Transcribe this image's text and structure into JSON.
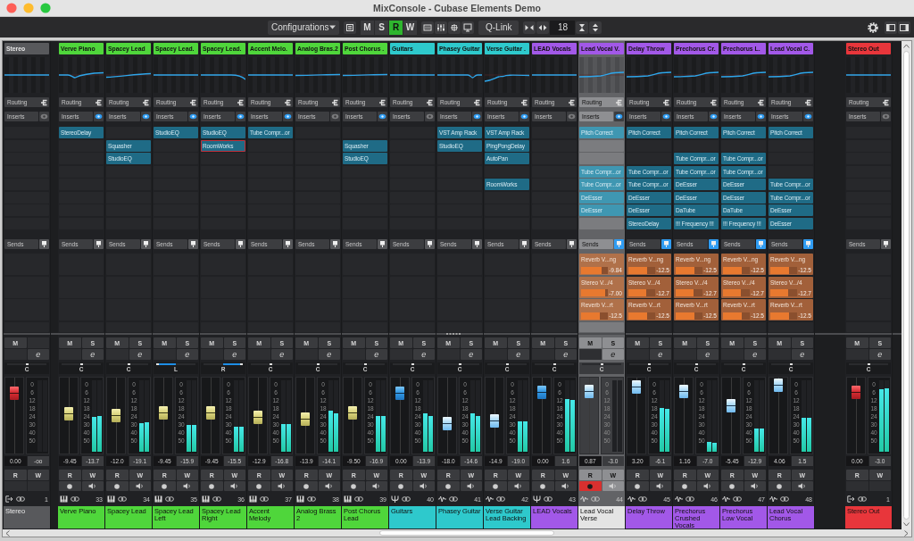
{
  "window": {
    "title": "MixConsole - Cubase Elements Demo"
  },
  "toolbar": {
    "configurations": "Configurations",
    "modes": [
      {
        "label": "M",
        "on": false
      },
      {
        "label": "S",
        "on": false
      },
      {
        "label": "R",
        "on": true
      },
      {
        "label": "W",
        "on": false
      }
    ],
    "qlink": "Q-Link",
    "visible_channels": "18"
  },
  "input_strip": {
    "name": "Stereo",
    "color": "#58595c",
    "kind": "input",
    "selected": false,
    "eq": {
      "kind": "flat"
    },
    "routing": "Routing",
    "inserts_label": "Inserts",
    "inserts_on": false,
    "sends_label": "Sends",
    "sends_on": false,
    "mute": "M",
    "edit": "e",
    "pan": {
      "label": "C",
      "level": 0.5
    },
    "fader": {
      "level": 0.86
    },
    "scale": [
      "0",
      "6",
      "12",
      "18",
      "24",
      "30",
      "40",
      "50"
    ],
    "volume": "0.00",
    "peak": "-oo",
    "read": "R",
    "write": "W",
    "number": "1",
    "full_name": "Stereo"
  },
  "channels": [
    {
      "name": "Verve Piano",
      "color": "#4fd63b",
      "kind": "instrument",
      "selected": false,
      "eq": {
        "kind": "dip"
      },
      "routing": "Routing",
      "inserts_label": "Inserts",
      "inserts_on": true,
      "inserts": [
        {
          "kind": "plugin",
          "name": "StereoDelay"
        }
      ],
      "sends_label": "Sends",
      "sends_on": false,
      "mute": "M",
      "solo": "S",
      "edit": "e",
      "pan": {
        "label": "C",
        "level": 0.5
      },
      "fader": {
        "level": 0.53
      },
      "scale": [
        "0",
        "6",
        "12",
        "18",
        "24",
        "30",
        "40",
        "50"
      ],
      "meter": [
        {
          "level": 0.49
        },
        {
          "level": 0.5
        }
      ],
      "volume": "-9.45",
      "peak": "-13.7",
      "read": "R",
      "write": "W",
      "record": false,
      "number": "33",
      "full_name": "Verve Piano"
    },
    {
      "name": "Spacey Lead",
      "color": "#4fd63b",
      "kind": "instrument",
      "selected": false,
      "eq": {
        "kind": "rise"
      },
      "routing": "Routing",
      "inserts_label": "Inserts",
      "inserts_on": true,
      "inserts": [
        {
          "kind": "empty"
        },
        {
          "kind": "plugin",
          "name": "Squasher"
        },
        {
          "kind": "plugin",
          "name": "StudioEQ"
        }
      ],
      "sends_label": "Sends",
      "sends_on": false,
      "mute": "M",
      "solo": "S",
      "edit": "e",
      "pan": {
        "label": "C",
        "level": 0.5
      },
      "fader": {
        "level": 0.5
      },
      "scale": [
        "0",
        "6",
        "12",
        "18",
        "24",
        "30",
        "40",
        "50"
      ],
      "meter": [
        {
          "level": 0.4
        },
        {
          "level": 0.41
        }
      ],
      "volume": "-12.0",
      "peak": "-19.1",
      "read": "R",
      "write": "W",
      "record": false,
      "number": "34",
      "full_name": "Spacey Lead"
    },
    {
      "name": "Spacey Lead.",
      "color": "#4fd63b",
      "kind": "instrument",
      "selected": false,
      "eq": {
        "kind": "flat"
      },
      "routing": "Routing",
      "inserts_label": "Inserts",
      "inserts_on": true,
      "inserts": [
        {
          "kind": "plugin",
          "name": "StudioEQ"
        }
      ],
      "sends_label": "Sends",
      "sends_on": false,
      "mute": "M",
      "solo": "S",
      "edit": "e",
      "pan": {
        "label": "L",
        "level": 0
      },
      "fader": {
        "level": 0.54
      },
      "scale": [
        "0",
        "6",
        "12",
        "18",
        "24",
        "30",
        "40",
        "50"
      ],
      "meter": [
        {
          "level": 0.37
        },
        {
          "level": 0.37
        }
      ],
      "volume": "-9.45",
      "peak": "-15.9",
      "read": "R",
      "write": "W",
      "record": false,
      "number": "35",
      "full_name": "Spacey Lead Left"
    },
    {
      "name": "Spacey Lead.",
      "color": "#4fd63b",
      "kind": "instrument",
      "selected": false,
      "eq": {
        "kind": "fall"
      },
      "routing": "Routing",
      "inserts_label": "Inserts",
      "inserts_on": true,
      "inserts": [
        {
          "kind": "plugin",
          "name": "StudioEQ"
        },
        {
          "kind": "marked",
          "name": "RoomWorks"
        }
      ],
      "sends_label": "Sends",
      "sends_on": false,
      "mute": "M",
      "solo": "S",
      "edit": "e",
      "pan": {
        "label": "R",
        "level": 1
      },
      "fader": {
        "level": 0.54
      },
      "scale": [
        "0",
        "6",
        "12",
        "18",
        "24",
        "30",
        "40",
        "50"
      ],
      "meter": [
        {
          "level": 0.35
        },
        {
          "level": 0.35
        }
      ],
      "volume": "-9.45",
      "peak": "-15.5",
      "read": "R",
      "write": "W",
      "record": false,
      "number": "36",
      "full_name": "Spacey Lead Right"
    },
    {
      "name": "Accent Melo.",
      "color": "#4fd63b",
      "kind": "instrument",
      "selected": false,
      "eq": {
        "kind": "flat"
      },
      "routing": "Routing",
      "inserts_label": "Inserts",
      "inserts_on": true,
      "inserts": [
        {
          "kind": "plugin",
          "name": "Tube Compr...or"
        }
      ],
      "sends_label": "Sends",
      "sends_on": false,
      "mute": "M",
      "solo": "S",
      "edit": "e",
      "pan": {
        "label": "C",
        "level": 0.5
      },
      "fader": {
        "level": 0.47
      },
      "scale": [
        "0",
        "6",
        "12",
        "18",
        "24",
        "30",
        "40",
        "50"
      ],
      "meter": [
        {
          "level": 0.39
        },
        {
          "level": 0.39
        }
      ],
      "volume": "-12.9",
      "peak": "-16.8",
      "read": "R",
      "write": "W",
      "record": false,
      "number": "37",
      "full_name": "Accent Melody"
    },
    {
      "name": "Analog Bras.2",
      "color": "#4fd63b",
      "kind": "instrument",
      "selected": false,
      "eq": {
        "kind": "gentle"
      },
      "routing": "Routing",
      "inserts_label": "Inserts",
      "inserts_on": false,
      "sends_label": "Sends",
      "sends_on": false,
      "mute": "M",
      "solo": "S",
      "edit": "e",
      "pan": {
        "label": "C",
        "level": 0.5
      },
      "fader": {
        "level": 0.44
      },
      "scale": [
        "0",
        "6",
        "12",
        "18",
        "24",
        "30",
        "40",
        "50"
      ],
      "meter": [
        {
          "level": 0.57
        },
        {
          "level": 0.54
        }
      ],
      "volume": "-13.9",
      "peak": "-14.1",
      "read": "R",
      "write": "W",
      "record": false,
      "number": "38",
      "full_name": "Analog Brass 2"
    },
    {
      "name": "Post Chorus .",
      "color": "#4fd63b",
      "kind": "instrument",
      "selected": false,
      "eq": {
        "kind": "gentle"
      },
      "routing": "Routing",
      "inserts_label": "Inserts",
      "inserts_on": true,
      "inserts": [
        {
          "kind": "empty"
        },
        {
          "kind": "plugin",
          "name": "Squasher"
        },
        {
          "kind": "plugin",
          "name": "StudioEQ"
        }
      ],
      "sends_label": "Sends",
      "sends_on": false,
      "mute": "M",
      "solo": "S",
      "edit": "e",
      "pan": {
        "label": "C",
        "level": 0.5
      },
      "fader": {
        "level": 0.54
      },
      "scale": [
        "0",
        "6",
        "12",
        "18",
        "24",
        "30",
        "40",
        "50"
      ],
      "meter": [
        {
          "level": 0.5
        },
        {
          "level": 0.5
        }
      ],
      "volume": "-9.50",
      "peak": "-16.9",
      "read": "R",
      "write": "W",
      "record": false,
      "number": "39",
      "full_name": "Post Chorus Lead"
    },
    {
      "name": "Guitars",
      "color": "#2ec9cc",
      "kind": "group",
      "selected": false,
      "eq": {
        "kind": "flat"
      },
      "routing": "Routing",
      "inserts_label": "Inserts",
      "inserts_on": false,
      "sends_label": "Sends",
      "sends_on": false,
      "mute": "M",
      "solo": "S",
      "edit": "e",
      "pan": {
        "label": "C",
        "level": 0.5
      },
      "fader": {
        "level": 0.86
      },
      "scale": [
        "0",
        "6",
        "12",
        "18",
        "24",
        "30",
        "40",
        "50"
      ],
      "meter": [
        {
          "level": 0.54
        },
        {
          "level": 0.5
        }
      ],
      "volume": "0.00",
      "peak": "-13.9",
      "read": "R",
      "write": "W",
      "record": false,
      "number": "40",
      "full_name": "Guitars"
    },
    {
      "name": "Phasey Guitar",
      "color": "#2ec9cc",
      "kind": "audio",
      "selected": false,
      "eq": {
        "kind": "notch"
      },
      "routing": "Routing",
      "inserts_label": "Inserts",
      "inserts_on": true,
      "inserts": [
        {
          "kind": "plugin",
          "name": "VST Amp Rack"
        },
        {
          "kind": "plugin",
          "name": "StudioEQ"
        }
      ],
      "sends_label": "Sends",
      "sends_on": false,
      "mute": "M",
      "solo": "S",
      "edit": "e",
      "pan": {
        "label": "C",
        "level": 0.5
      },
      "fader": {
        "level": 0.37
      },
      "scale": [
        "0",
        "6",
        "12",
        "18",
        "24",
        "30",
        "40",
        "50"
      ],
      "meter": [
        {
          "level": 0.54
        },
        {
          "level": 0.5
        }
      ],
      "volume": "-18.0",
      "peak": "-14.6",
      "read": "R",
      "write": "W",
      "record": false,
      "number": "41",
      "full_name": "Phasey Guitar"
    },
    {
      "name": "Verse Guitar .",
      "color": "#2ec9cc",
      "kind": "audio",
      "selected": false,
      "eq": {
        "kind": "lowcut"
      },
      "routing": "Routing",
      "inserts_label": "Inserts",
      "inserts_on": true,
      "inserts": [
        {
          "kind": "plugin",
          "name": "VST Amp Rack"
        },
        {
          "kind": "plugin",
          "name": "PingPongDelay"
        },
        {
          "kind": "plugin",
          "name": "AutoPan"
        },
        {
          "kind": "empty"
        },
        {
          "kind": "plugin",
          "name": "RoomWorks"
        }
      ],
      "sends_label": "Sends",
      "sends_on": false,
      "mute": "M",
      "solo": "S",
      "edit": "e",
      "pan": {
        "label": "C",
        "level": 0.5
      },
      "fader": {
        "level": 0.41
      },
      "scale": [
        "0",
        "6",
        "12",
        "18",
        "24",
        "30",
        "40",
        "50"
      ],
      "meter": [
        {
          "level": 0.42
        },
        {
          "level": 0.42
        }
      ],
      "volume": "-14.9",
      "peak": "-19.0",
      "read": "R",
      "write": "W",
      "record": false,
      "number": "42",
      "full_name": "Verse Guitar Lead Backing"
    },
    {
      "name": "LEAD Vocals",
      "color": "#a258e8",
      "kind": "group",
      "selected": false,
      "eq": {
        "kind": "flat"
      },
      "routing": "Routing",
      "inserts_label": "Inserts",
      "inserts_on": false,
      "sends_label": "Sends",
      "sends_on": false,
      "mute": "M",
      "solo": "S",
      "edit": "e",
      "pan": {
        "label": "C",
        "level": 0.5
      },
      "fader": {
        "level": 0.87
      },
      "scale": [
        "0",
        "6",
        "12",
        "18",
        "24",
        "30",
        "40",
        "50"
      ],
      "meter": [
        {
          "level": 0.74
        },
        {
          "level": 0.72
        }
      ],
      "volume": "0.00",
      "peak": "1.6",
      "read": "R",
      "write": "W",
      "record": false,
      "number": "43",
      "full_name": "LEAD Vocals"
    },
    {
      "name": "Lead Vocal V.",
      "color": "#a258e8",
      "kind": "audio",
      "selected": true,
      "eq": {
        "kind": "vocal"
      },
      "routing": "Routing",
      "inserts_label": "Inserts",
      "inserts_on": true,
      "inserts": [
        {
          "kind": "plugin",
          "name": "Pitch Correct"
        },
        {
          "kind": "empty"
        },
        {
          "kind": "empty"
        },
        {
          "kind": "plugin",
          "name": "Tube Compr...or"
        },
        {
          "kind": "plugin",
          "name": "Tube Compr...or"
        },
        {
          "kind": "plugin",
          "name": "DeEsser"
        },
        {
          "kind": "plugin",
          "name": "DeEsser"
        }
      ],
      "sends_label": "Sends",
      "sends_on": true,
      "sends": [
        {
          "name": "Reverb V...ng",
          "level": 0.78,
          "value": "-9.84"
        },
        {
          "name": "Stereo V.../4",
          "level": 0.91,
          "value": "-7.00"
        },
        {
          "name": "Reverb V...rt",
          "level": 0.69,
          "value": "-12.5"
        }
      ],
      "mute": "M",
      "solo": "S",
      "edit": "e",
      "pan": {
        "label": "C",
        "level": 0.5
      },
      "fader": {
        "level": 0.89
      },
      "scale": [
        "0",
        "6",
        "12",
        "18",
        "24",
        "30",
        "40",
        "50"
      ],
      "volume": "0.87",
      "peak": "-3.0",
      "read": "R",
      "write": "W",
      "record": true,
      "number": "44",
      "full_name": "Lead Vocal Verse"
    },
    {
      "name": "Delay Throw",
      "color": "#a258e8",
      "kind": "audio",
      "selected": false,
      "eq": {
        "kind": "vocal"
      },
      "routing": "Routing",
      "inserts_label": "Inserts",
      "inserts_on": true,
      "inserts": [
        {
          "kind": "plugin",
          "name": "Pitch Correct"
        },
        {
          "kind": "empty"
        },
        {
          "kind": "empty"
        },
        {
          "kind": "plugin",
          "name": "Tube Compr...or"
        },
        {
          "kind": "plugin",
          "name": "Tube Compr...or"
        },
        {
          "kind": "plugin",
          "name": "DeEsser"
        },
        {
          "kind": "plugin",
          "name": "DeEsser"
        },
        {
          "kind": "plugin",
          "name": "StereoDelay"
        }
      ],
      "sends_label": "Sends",
      "sends_on": true,
      "sends": [
        {
          "name": "Reverb V...ng",
          "level": 0.69,
          "value": "-12.5"
        },
        {
          "name": "Stereo V.../4",
          "level": 0.67,
          "value": "-12.7"
        },
        {
          "name": "Reverb V...rt",
          "level": 0.69,
          "value": "-12.5"
        }
      ],
      "mute": "M",
      "solo": "S",
      "edit": "e",
      "pan": {
        "label": "C",
        "level": 0.5
      },
      "fader": {
        "level": 0.96
      },
      "scale": [
        "0",
        "6",
        "12",
        "18",
        "24",
        "30",
        "40",
        "50"
      ],
      "meter": [
        {
          "level": 0.61
        },
        {
          "level": 0.6
        }
      ],
      "volume": "3.20",
      "peak": "-6.1",
      "read": "R",
      "write": "W",
      "record": false,
      "number": "45",
      "full_name": "Delay Throw"
    },
    {
      "name": "Prechorus Cr.",
      "color": "#a258e8",
      "kind": "audio",
      "selected": false,
      "eq": {
        "kind": "vocal"
      },
      "routing": "Routing",
      "inserts_label": "Inserts",
      "inserts_on": true,
      "inserts": [
        {
          "kind": "plugin",
          "name": "Pitch Correct"
        },
        {
          "kind": "empty"
        },
        {
          "kind": "plugin",
          "name": "Tube Compr...or"
        },
        {
          "kind": "plugin",
          "name": "Tube Compr...or"
        },
        {
          "kind": "plugin",
          "name": "DeEsser"
        },
        {
          "kind": "plugin",
          "name": "DeEsser"
        },
        {
          "kind": "plugin",
          "name": "DaTube"
        },
        {
          "kind": "plugin",
          "name": "!!! Frequency !!!"
        }
      ],
      "sends_label": "Sends",
      "sends_on": true,
      "sends": [
        {
          "name": "Reverb V...ng",
          "level": 0.69,
          "value": "-12.5"
        },
        {
          "name": "Stereo V.../4",
          "level": 0.67,
          "value": "-12.7"
        },
        {
          "name": "Reverb V...rt",
          "level": 0.69,
          "value": "-12.5"
        }
      ],
      "mute": "M",
      "solo": "S",
      "edit": "e",
      "pan": {
        "label": "C",
        "level": 0.5
      },
      "fader": {
        "level": 0.89
      },
      "scale": [
        "0",
        "6",
        "12",
        "18",
        "24",
        "30",
        "40",
        "50"
      ],
      "meter": [
        {
          "level": 0.14
        },
        {
          "level": 0.13
        }
      ],
      "volume": "1.16",
      "peak": "-7.0",
      "read": "R",
      "write": "W",
      "record": false,
      "number": "46",
      "full_name": "Prechorus Crushed Vocals"
    },
    {
      "name": "Prechorus L.",
      "color": "#a258e8",
      "kind": "audio",
      "selected": false,
      "eq": {
        "kind": "vocal"
      },
      "routing": "Routing",
      "inserts_label": "Inserts",
      "inserts_on": true,
      "inserts": [
        {
          "kind": "plugin",
          "name": "Pitch Correct"
        },
        {
          "kind": "empty"
        },
        {
          "kind": "plugin",
          "name": "Tube Compr...or"
        },
        {
          "kind": "plugin",
          "name": "Tube Compr...or"
        },
        {
          "kind": "plugin",
          "name": "DeEsser"
        },
        {
          "kind": "plugin",
          "name": "DeEsser"
        },
        {
          "kind": "plugin",
          "name": "DaTube"
        },
        {
          "kind": "plugin",
          "name": "!!! Frequency !!!"
        }
      ],
      "sends_label": "Sends",
      "sends_on": true,
      "sends": [
        {
          "name": "Reverb V...ng",
          "level": 0.69,
          "value": "-12.5"
        },
        {
          "name": "Stereo V.../4",
          "level": 0.67,
          "value": "-12.7"
        },
        {
          "name": "Reverb V...rt",
          "level": 0.69,
          "value": "-12.5"
        }
      ],
      "mute": "M",
      "solo": "S",
      "edit": "e",
      "pan": {
        "label": "C",
        "level": 0.5
      },
      "fader": {
        "level": 0.66
      },
      "scale": [
        "0",
        "6",
        "12",
        "18",
        "24",
        "30",
        "40",
        "50"
      ],
      "meter": [
        {
          "level": 0.32
        },
        {
          "level": 0.32
        }
      ],
      "volume": "-5.45",
      "peak": "-12.9",
      "read": "R",
      "write": "W",
      "record": false,
      "number": "47",
      "full_name": "Prechorus Low Vocal"
    },
    {
      "name": "Lead Vocal C.",
      "color": "#a258e8",
      "kind": "audio",
      "selected": false,
      "eq": {
        "kind": "vocal"
      },
      "routing": "Routing",
      "inserts_label": "Inserts",
      "inserts_on": true,
      "inserts": [
        {
          "kind": "plugin",
          "name": "Pitch Correct"
        },
        {
          "kind": "empty"
        },
        {
          "kind": "empty"
        },
        {
          "kind": "empty"
        },
        {
          "kind": "plugin",
          "name": "Tube Compr...or"
        },
        {
          "kind": "plugin",
          "name": "Tube Compr...or"
        },
        {
          "kind": "plugin",
          "name": "DeEsser"
        },
        {
          "kind": "plugin",
          "name": "DeEsser"
        }
      ],
      "sends_label": "Sends",
      "sends_on": true,
      "sends": [
        {
          "name": "Reverb V...ng",
          "level": 0.69,
          "value": "-12.5"
        },
        {
          "name": "Stereo V.../4",
          "level": 0.67,
          "value": "-12.7"
        },
        {
          "name": "Reverb V...rt",
          "level": 0.69,
          "value": "-12.5"
        }
      ],
      "mute": "M",
      "solo": "S",
      "edit": "e",
      "pan": {
        "label": "C",
        "level": 0.5
      },
      "fader": {
        "level": 0.99
      },
      "scale": [
        "0",
        "6",
        "12",
        "18",
        "24",
        "30",
        "40",
        "50"
      ],
      "meter": [
        {
          "level": 0.47
        },
        {
          "level": 0.47
        }
      ],
      "volume": "4.06",
      "peak": "1.5",
      "read": "R",
      "write": "W",
      "record": false,
      "number": "48",
      "full_name": "Lead Vocal Chorus"
    }
  ],
  "output_strip": {
    "name": "Stereo Out",
    "color": "#e8363b",
    "kind": "output",
    "selected": false,
    "eq": {
      "kind": "flat"
    },
    "routing": "Routing",
    "inserts_label": "Inserts",
    "inserts_on": false,
    "sends_label": "Sends",
    "sends_on": false,
    "mute": "M",
    "solo": "S",
    "edit": "e",
    "pan": {
      "label": "C",
      "level": 0.5
    },
    "fader": {
      "level": 0.87
    },
    "scale": [
      "0",
      "6",
      "12",
      "18",
      "24",
      "30",
      "40",
      "50"
    ],
    "meter": [
      {
        "level": 0.87
      },
      {
        "level": 0.89
      }
    ],
    "volume": "0.00",
    "peak": "-3.0",
    "read": "R",
    "write": "W",
    "number": "1",
    "full_name": "Stereo Out"
  }
}
